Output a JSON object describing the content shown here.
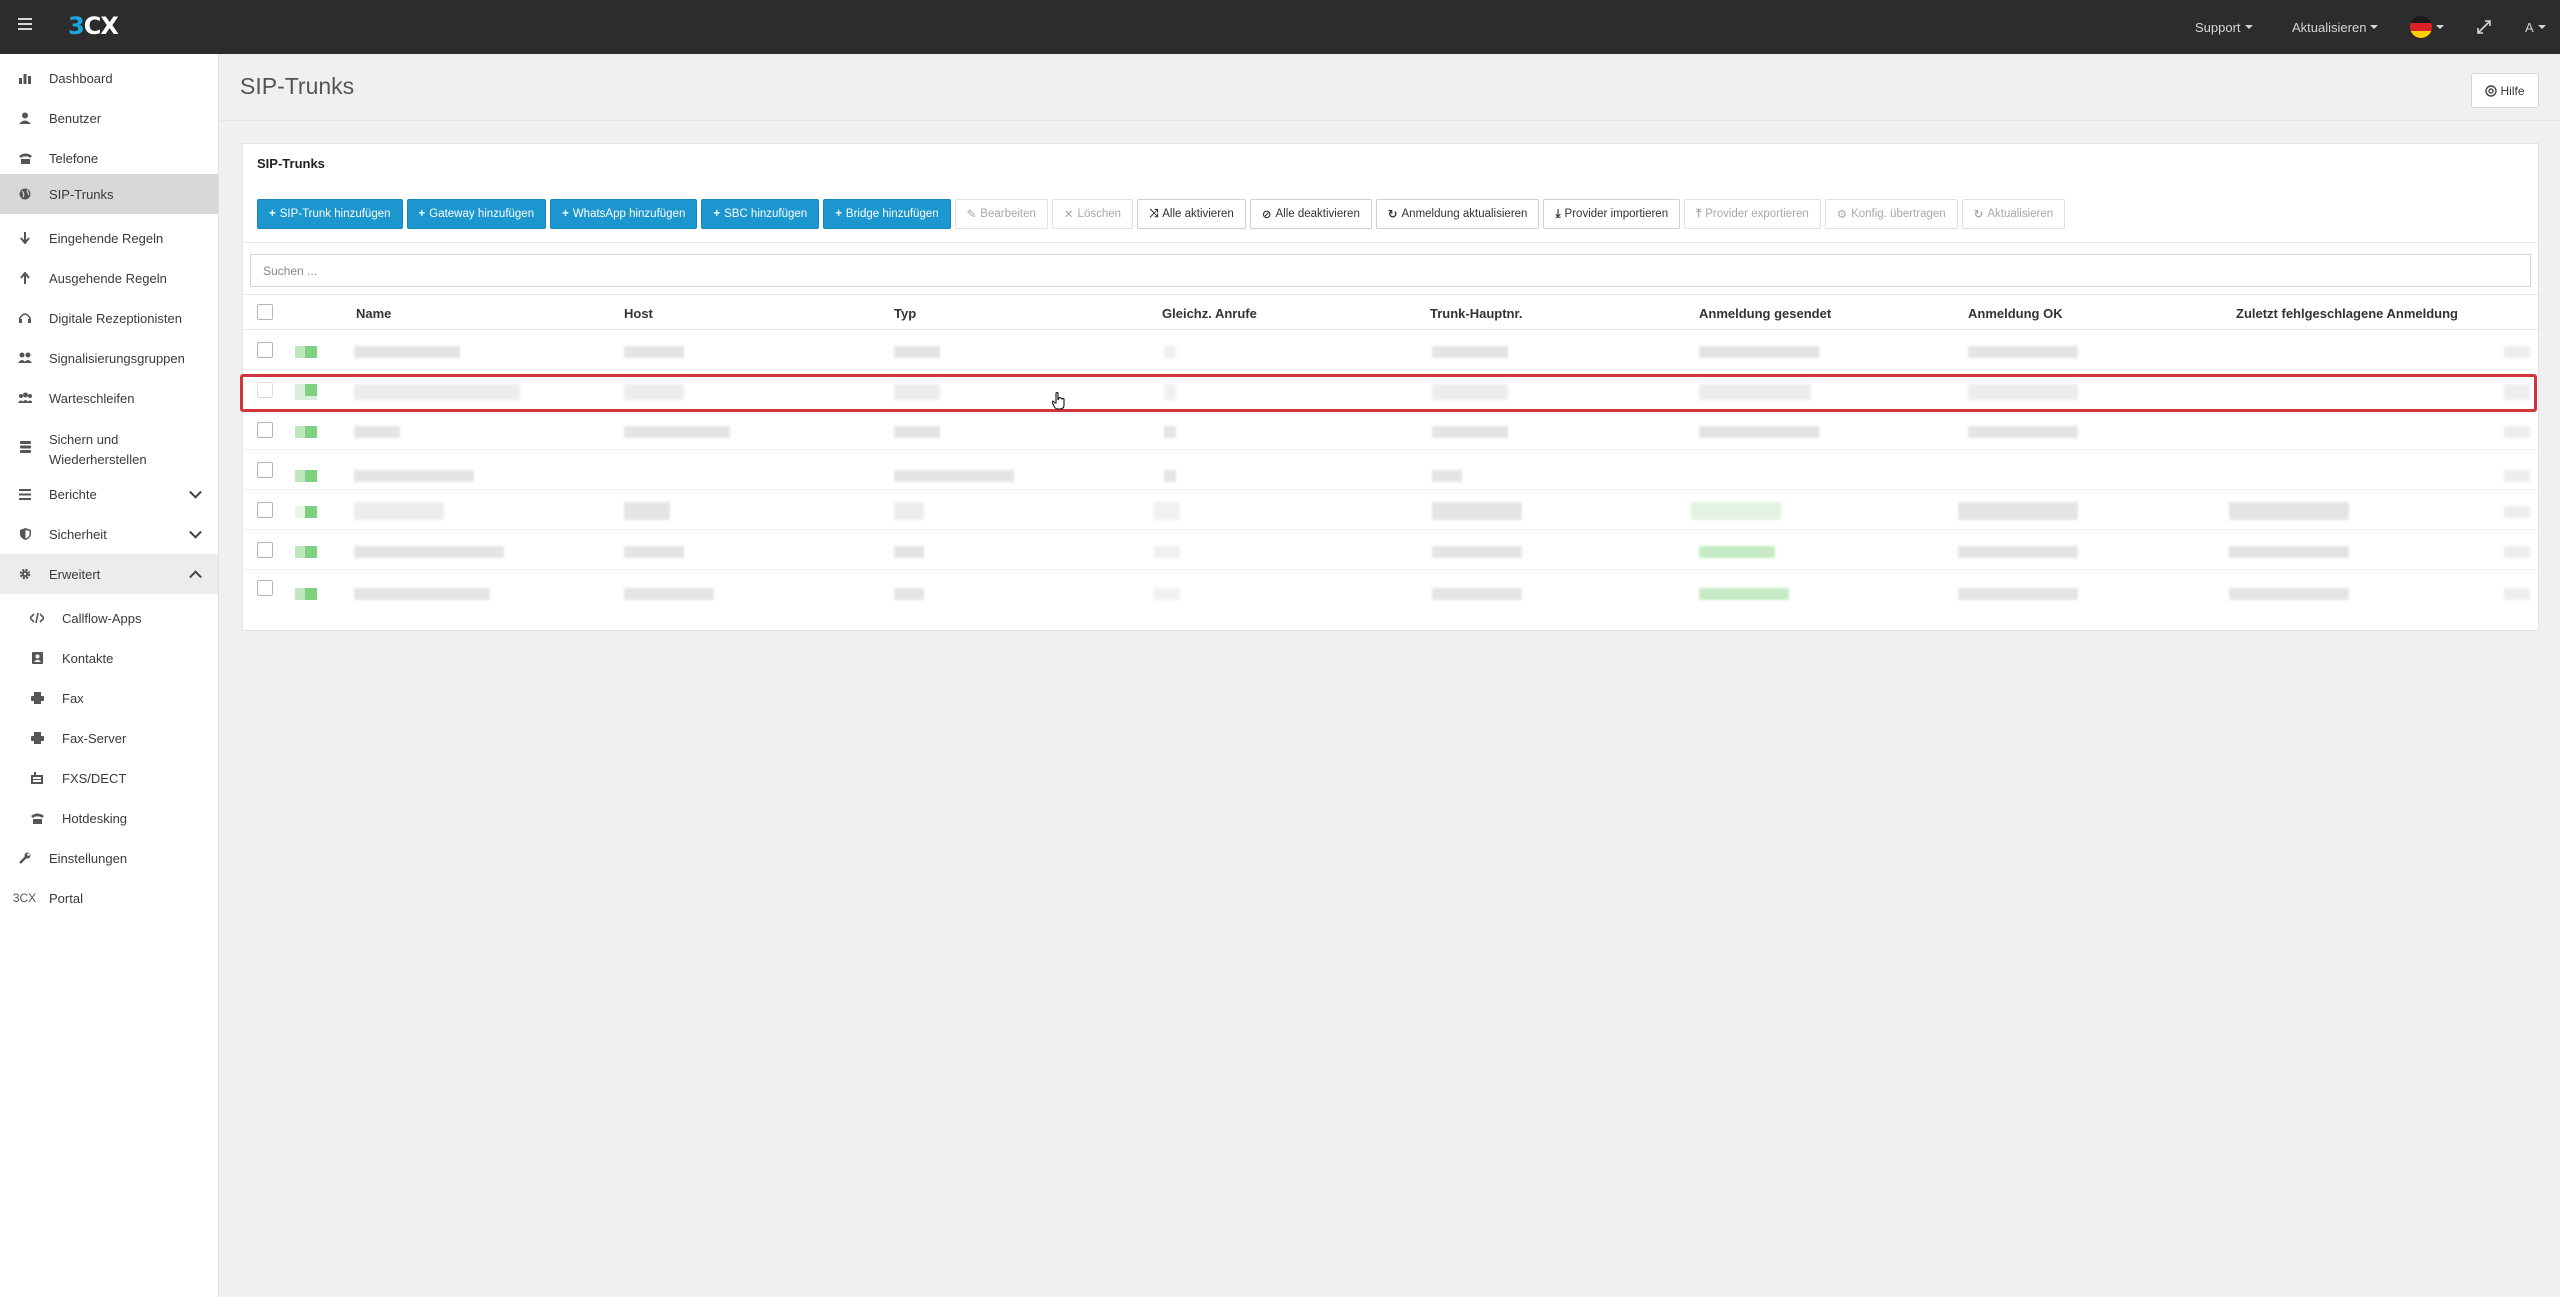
{
  "app": {
    "logo_prefix": "3",
    "logo_suffix": "CX"
  },
  "topbar": {
    "support": "Support",
    "update": "Aktualisieren",
    "user_initial": "A",
    "language_flag": "de-flag-icon",
    "fullscreen_icon": "expand-icon"
  },
  "sidebar": {
    "items": [
      {
        "label": "Dashboard",
        "icon": "bar-chart-icon"
      },
      {
        "label": "Benutzer",
        "icon": "user-icon"
      },
      {
        "label": "Telefone",
        "icon": "phone-icon"
      },
      {
        "label": "SIP-Trunks",
        "icon": "globe-icon",
        "active": true
      },
      {
        "label": "Eingehende Regeln",
        "icon": "arrow-down-icon"
      },
      {
        "label": "Ausgehende Regeln",
        "icon": "arrow-up-icon"
      },
      {
        "label": "Digitale Rezeptionisten",
        "icon": "headset-icon"
      },
      {
        "label": "Signalisierungsgruppen",
        "icon": "users-icon"
      },
      {
        "label": "Warteschleifen",
        "icon": "group-icon"
      },
      {
        "label": "Sichern und",
        "label2": "Wiederherstellen",
        "icon": "database-icon"
      },
      {
        "label": "Berichte",
        "icon": "list-icon"
      },
      {
        "label": "Sicherheit",
        "icon": "shield-icon"
      },
      {
        "label": "Erweitert",
        "icon": "gear-icon"
      },
      {
        "label": "Callflow-Apps",
        "icon": "code-icon"
      },
      {
        "label": "Kontakte",
        "icon": "contact-book-icon"
      },
      {
        "label": "Fax",
        "icon": "fax-icon"
      },
      {
        "label": "Fax-Server",
        "icon": "fax-server-icon"
      },
      {
        "label": "FXS/DECT",
        "icon": "fxs-icon"
      },
      {
        "label": "Hotdesking",
        "icon": "phone-desk-icon"
      },
      {
        "label": "Einstellungen",
        "icon": "wrench-icon"
      },
      {
        "label": "Portal",
        "icon": "3cx-portal-icon",
        "icon_text": "3CX"
      }
    ]
  },
  "page": {
    "title": "SIP-Trunks",
    "help": "Hilfe"
  },
  "panel": {
    "title": "SIP-Trunks",
    "search_placeholder": "Suchen ..."
  },
  "toolbar": {
    "add_sip_trunk": "SIP-Trunk hinzufügen",
    "add_gateway": "Gateway hinzufügen",
    "add_whatsapp": "WhatsApp hinzufügen",
    "add_sbc": "SBC hinzufügen",
    "add_bridge": "Bridge hinzufügen",
    "edit": "Bearbeiten",
    "delete": "Löschen",
    "enable_all": "Alle aktivieren",
    "disable_all": "Alle deaktivieren",
    "refresh_registration": "Anmeldung aktualisieren",
    "import_provider": "Provider importieren",
    "export_provider": "Provider exportieren",
    "push_config": "Konfig. übertragen",
    "refresh": "Aktualisieren"
  },
  "table": {
    "columns": [
      "Name",
      "Host",
      "Typ",
      "Gleichz. Anrufe",
      "Trunk-Hauptnr.",
      "Anmeldung gesendet",
      "Anmeldung OK",
      "Zuletzt fehlgeschlagene Anmeldung"
    ],
    "row_count": 7,
    "highlighted_row": 2
  },
  "colors": {
    "accent": "#1b96cf",
    "highlight": "#d2343c",
    "topbar": "#2c2c2c"
  }
}
